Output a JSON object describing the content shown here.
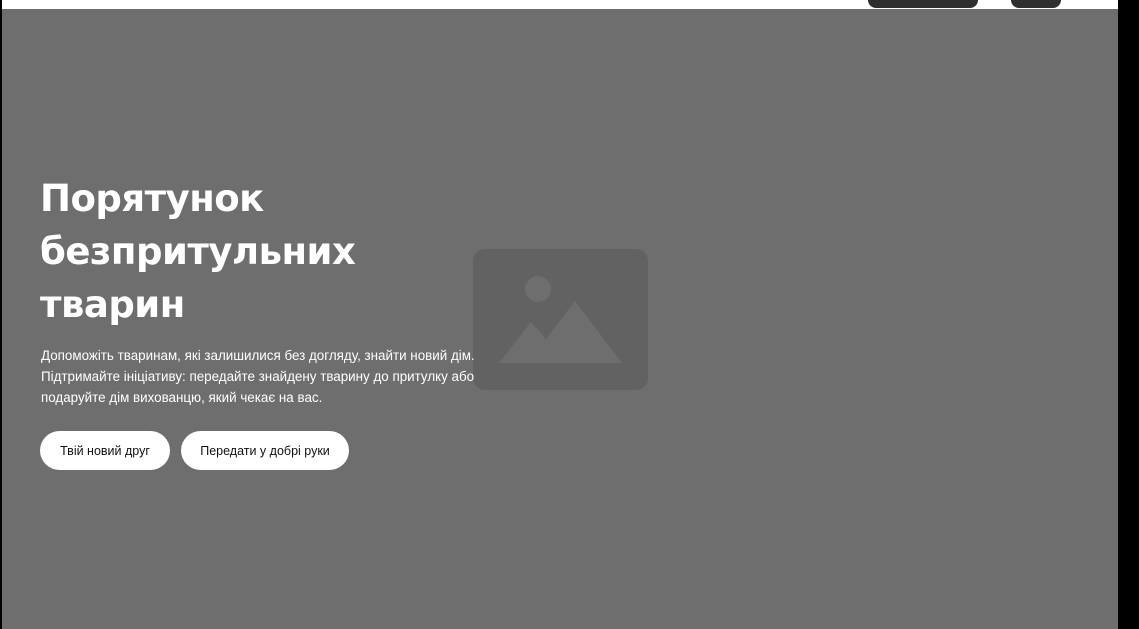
{
  "hero": {
    "title": "Порятунок безпритульних тварин",
    "description": "Допоможіть тваринам, які залишилися без догляду, знайти новий дім. Підтримайте ініціативу: передайте знайдену тварину до притулку або подаруйте дім вихованцю, який чекає на вас.",
    "primary_button": "Твій новий друг",
    "secondary_button": "Передати у добрі руки",
    "image_icon": "image-placeholder-icon"
  },
  "colors": {
    "hero_background": "#6e6e6e",
    "button_background": "#ffffff",
    "text": "#ffffff"
  }
}
